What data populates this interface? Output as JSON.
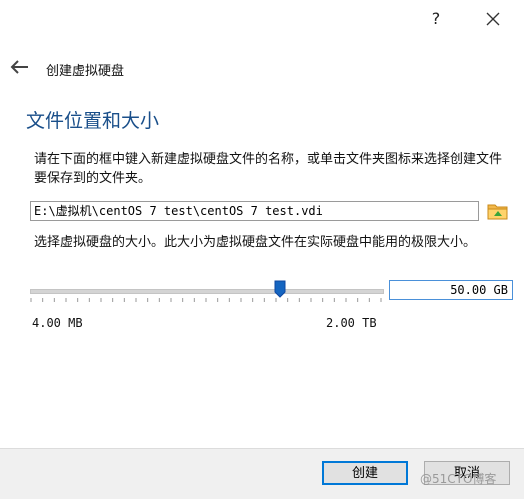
{
  "titlebar": {
    "help_label": "?"
  },
  "header": {
    "title": "创建虚拟硬盘"
  },
  "section": {
    "title": "文件位置和大小"
  },
  "location": {
    "description": "请在下面的框中键入新建虚拟硬盘文件的名称，或单击文件夹图标来选择创建文件要保存到的文件夹。",
    "path_value": "E:\\虚拟机\\centOS 7 test\\centOS 7 test.vdi"
  },
  "size": {
    "description": "选择虚拟硬盘的大小。此大小为虚拟硬盘文件在实际硬盘中能用的极限大小。",
    "value": "50.00 GB",
    "min_label": "4.00 MB",
    "max_label": "2.00 TB",
    "slider_fraction": 0.71
  },
  "buttons": {
    "create": "创建",
    "cancel": "取消"
  },
  "watermark": "@51CTO博客",
  "colors": {
    "accent": "#0078d7",
    "title": "#1a4f8a",
    "thumb": "#1565c0",
    "folder": "#f2b84b"
  },
  "icons": {
    "back": "arrow-left-icon",
    "close": "close-icon",
    "folder": "folder-icon"
  }
}
